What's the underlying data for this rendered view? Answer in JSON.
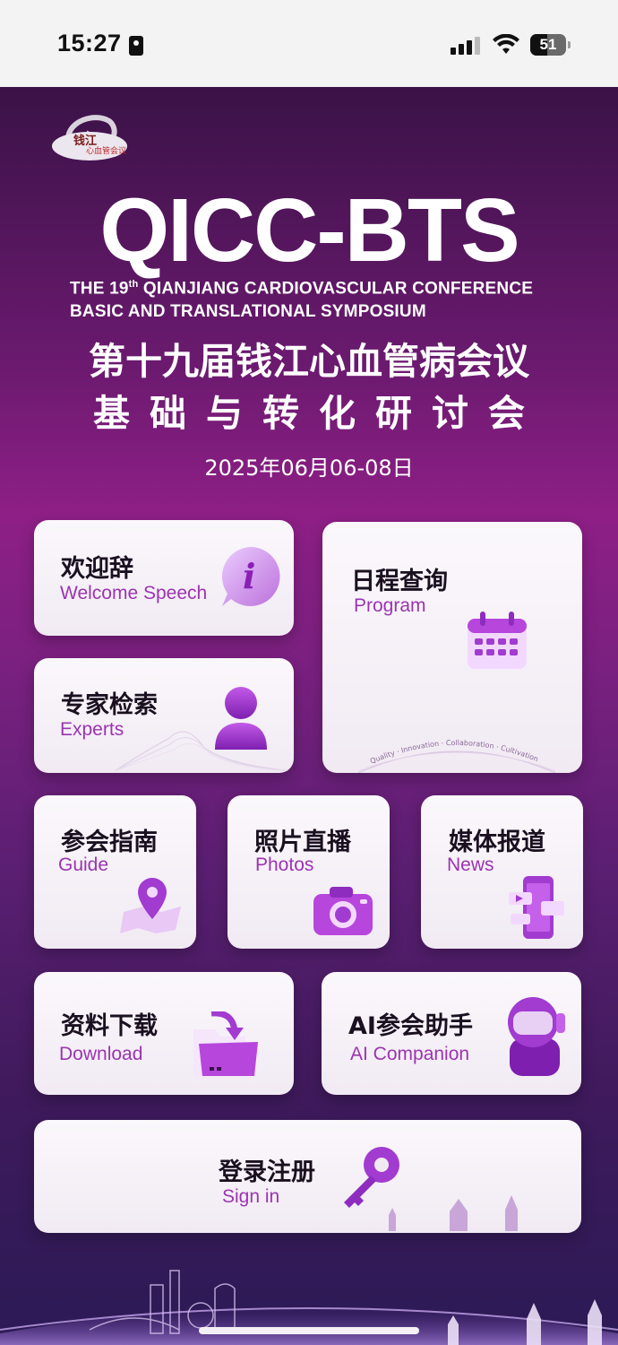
{
  "status_bar": {
    "time": "15:27",
    "battery": "51"
  },
  "header": {
    "logo_text": "钱江心血管会议",
    "title": "QICC-BTS",
    "subtitle_en_line1_pre": "THE 19",
    "subtitle_en_line1_sup": "th",
    "subtitle_en_line1_post": " QIANJIANG CARDIOVASCULAR CONFERENCE",
    "subtitle_en_line2": "BASIC  AND TRANSLATIONAL SYMPOSIUM",
    "subtitle_cn_line1": "第十九届钱江心血管病会议",
    "subtitle_cn_line2": "基础与转化研讨会",
    "date": "2025年06月06-08日"
  },
  "menu": {
    "welcome": {
      "cn": "欢迎辞",
      "en": "Welcome Speech"
    },
    "program": {
      "cn": "日程查询",
      "en": "Program",
      "arc_text": "Quality · Innovation · Collaboration · Cultivation"
    },
    "experts": {
      "cn": "专家检索",
      "en": "Experts"
    },
    "guide": {
      "cn": "参会指南",
      "en": "Guide"
    },
    "photos": {
      "cn": "照片直播",
      "en": "Photos"
    },
    "news": {
      "cn": "媒体报道",
      "en": "News"
    },
    "download": {
      "cn": "资料下载",
      "en": "Download"
    },
    "ai": {
      "cn": "AI参会助手",
      "en": "AI Companion"
    },
    "signin": {
      "cn": "登录注册",
      "en": "Sign in"
    }
  },
  "colors": {
    "accent": "#9b34b1",
    "icon_purple": "#a23bd0",
    "background_top": "#3a1247",
    "background_mid": "#8e1f86"
  }
}
